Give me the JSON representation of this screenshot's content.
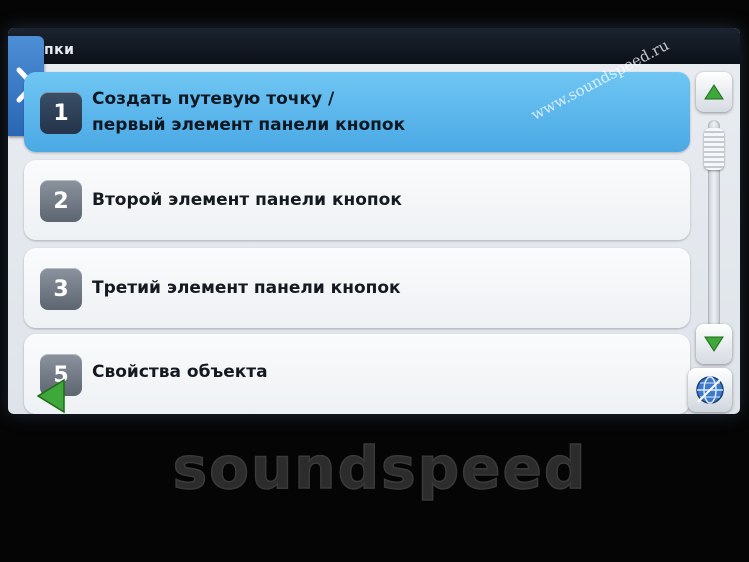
{
  "title_bar": {
    "title": "пки"
  },
  "list": {
    "items": [
      {
        "number": "1",
        "label": "Создать путевую точку /\nпервый элемент панели кнопок",
        "selected": true
      },
      {
        "number": "2",
        "label": "Второй элемент панели кнопок",
        "selected": false
      },
      {
        "number": "3",
        "label": "Третий элемент панели кнопок",
        "selected": false
      },
      {
        "number": "5",
        "label": "Свойства объекта",
        "selected": false
      }
    ]
  },
  "scrollbar": {
    "up_icon": "arrow-up-icon",
    "down_icon": "arrow-down-icon"
  },
  "buttons": {
    "back_icon": "back-arrow-icon",
    "globe_icon": "globe-icon",
    "tab_icon": "chevron-right-icon"
  },
  "watermark": {
    "text": "www.soundspeed.ru"
  },
  "logo": {
    "text": "soundspeed"
  },
  "colors": {
    "accent": "#4aa8e4",
    "title_bar": "#0c1118",
    "item_bg": "#f4f6f8",
    "arrow_green": "#3fa83a",
    "tab_blue": "#2a66b3"
  }
}
